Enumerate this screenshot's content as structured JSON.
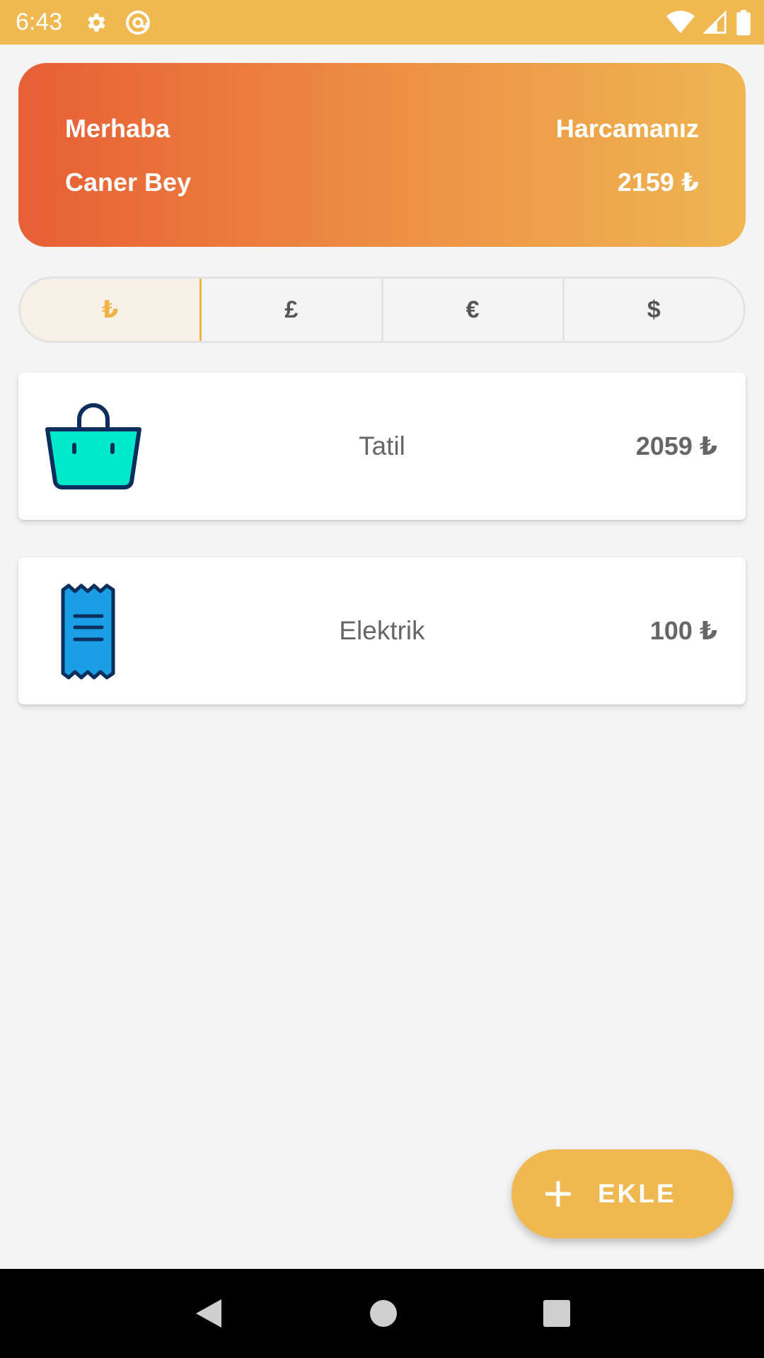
{
  "status_bar": {
    "time": "6:43",
    "icons": [
      "gear-icon",
      "at-sign-icon",
      "wifi-icon",
      "signal-icon",
      "battery-icon"
    ]
  },
  "header": {
    "greeting": "Merhaba",
    "user_name": "Caner Bey",
    "spend_label": "Harcamanız",
    "spend_total": "2159 ₺"
  },
  "currencies": [
    {
      "symbol": "₺",
      "selected": true
    },
    {
      "symbol": "£",
      "selected": false
    },
    {
      "symbol": "€",
      "selected": false
    },
    {
      "symbol": "$",
      "selected": false
    }
  ],
  "expenses": [
    {
      "name": "Tatil",
      "amount": "2059 ₺",
      "icon": "shopping-basket-icon"
    },
    {
      "name": "Elektrik",
      "amount": "100 ₺",
      "icon": "receipt-icon"
    }
  ],
  "fab": {
    "label": "EKLE",
    "icon": "plus-icon"
  },
  "nav_bar": {
    "icons": [
      "back-icon",
      "home-icon",
      "recents-icon"
    ]
  },
  "colors": {
    "accent": "#efb851",
    "gradient_start": "#e85e35",
    "gradient_end": "#efb651",
    "selected_currency": "#efb247"
  }
}
